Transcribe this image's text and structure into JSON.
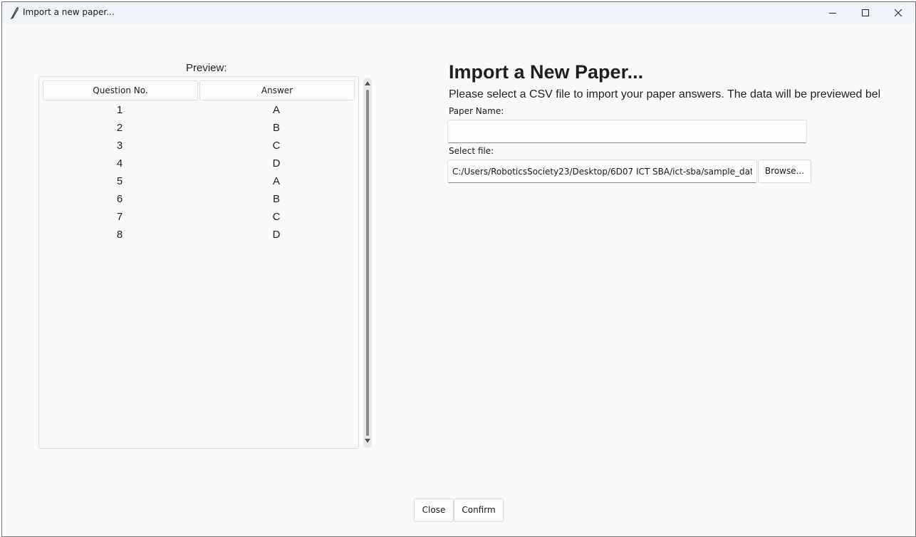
{
  "window": {
    "title": "Import a new paper...",
    "icon": "feather-icon"
  },
  "preview": {
    "label": "Preview:",
    "columns": [
      "Question No.",
      "Answer"
    ],
    "rows": [
      [
        "1",
        "A"
      ],
      [
        "2",
        "B"
      ],
      [
        "3",
        "C"
      ],
      [
        "4",
        "D"
      ],
      [
        "5",
        "A"
      ],
      [
        "6",
        "B"
      ],
      [
        "7",
        "C"
      ],
      [
        "8",
        "D"
      ]
    ]
  },
  "form": {
    "heading": "Import a New Paper...",
    "description": "Please select a CSV file to import your paper answers. The data will be previewed below.",
    "paper_name_label": "Paper Name:",
    "paper_name_value": "",
    "select_file_label": "Select file:",
    "file_path_value": "C:/Users/RoboticsSociety23/Desktop/6D07 ICT SBA/ict-sba/sample_data/",
    "browse_label": "Browse..."
  },
  "footer": {
    "close_label": "Close",
    "confirm_label": "Confirm"
  }
}
